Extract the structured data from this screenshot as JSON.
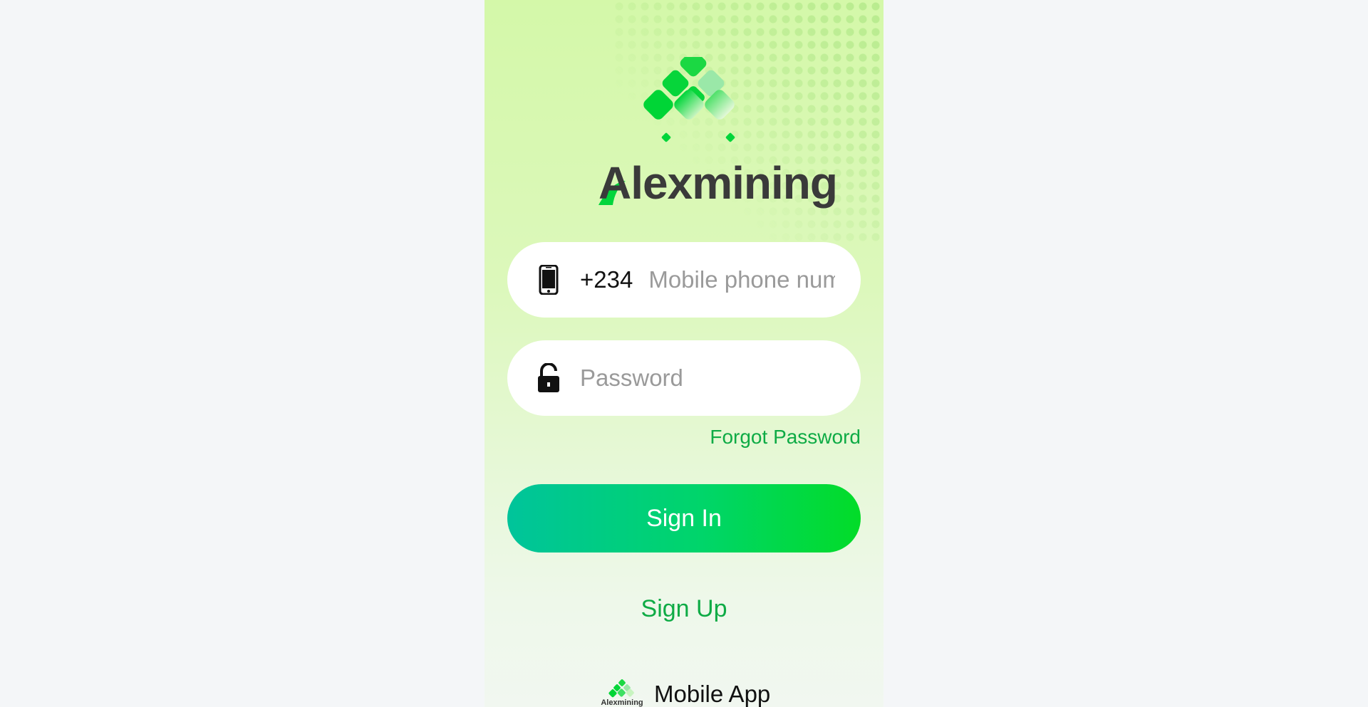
{
  "brand": {
    "name": "Alexmining",
    "accent_color": "#00d53a",
    "text_color": "#3a3a3a"
  },
  "login": {
    "phone": {
      "icon": "mobile-phone-icon",
      "country_code": "+234",
      "placeholder": "Mobile phone number",
      "value": ""
    },
    "password": {
      "icon": "unlock-icon",
      "placeholder": "Password",
      "value": ""
    },
    "forgot_label": "Forgot Password",
    "signin_label": "Sign In",
    "signup_label": "Sign Up"
  },
  "footer": {
    "mobile_app_label": "Mobile App",
    "mini_logo_text": "Alexmining"
  },
  "colors": {
    "link_green": "#0eab45",
    "button_gradient_start": "#00c49b",
    "button_gradient_end": "#02dc28",
    "page_background": "#f4f6f8"
  }
}
